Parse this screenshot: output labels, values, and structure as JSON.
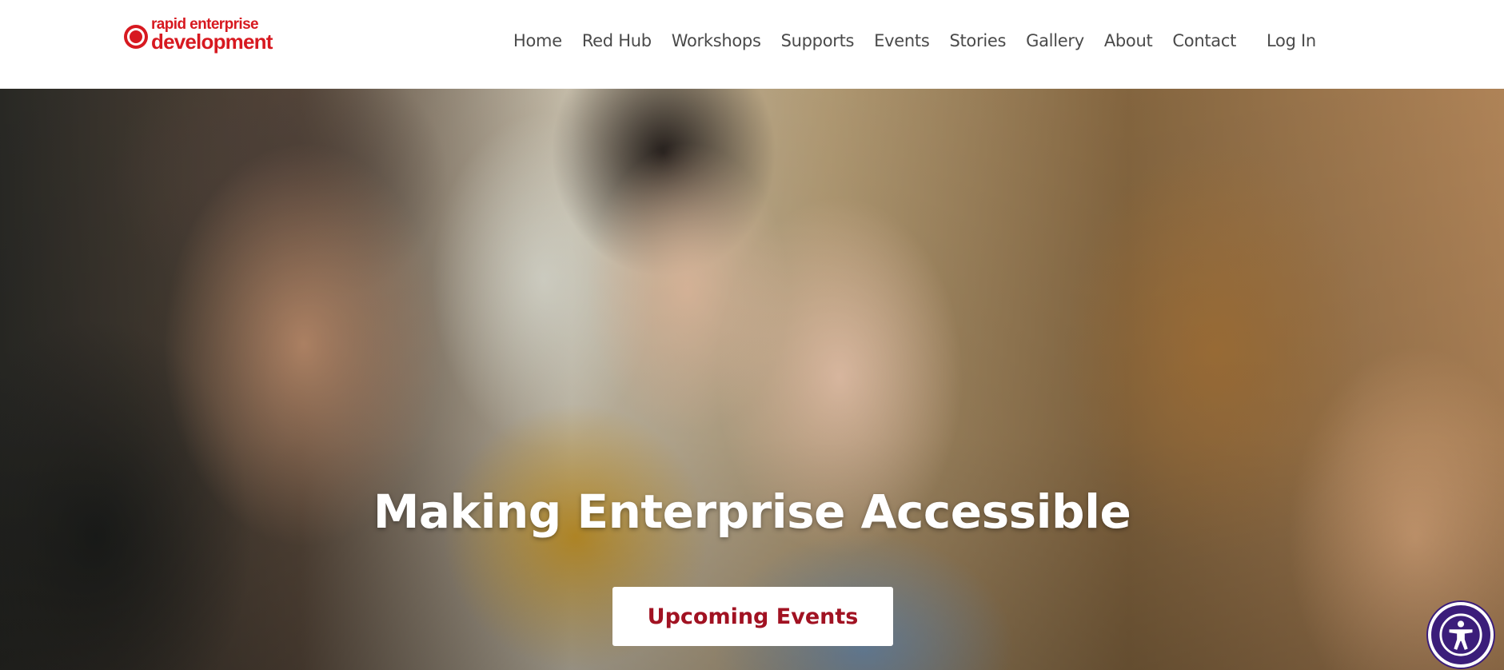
{
  "logo": {
    "line1": "rapid enterprise",
    "line2": "development"
  },
  "nav": {
    "items": [
      {
        "label": "Home"
      },
      {
        "label": "Red Hub"
      },
      {
        "label": "Workshops"
      },
      {
        "label": "Supports"
      },
      {
        "label": "Events"
      },
      {
        "label": "Stories"
      },
      {
        "label": "Gallery"
      },
      {
        "label": "About"
      },
      {
        "label": "Contact"
      }
    ],
    "login_label": "Log In"
  },
  "hero": {
    "title": "Making Enterprise Accessible",
    "cta_label": "Upcoming Events"
  },
  "accessibility_widget": {
    "icon": "accessibility-icon"
  },
  "colors": {
    "brand_red": "#d71920",
    "cta_text": "#a11222",
    "nav_text": "#4a4a4a",
    "widget_purple": "#3b1d7a"
  }
}
